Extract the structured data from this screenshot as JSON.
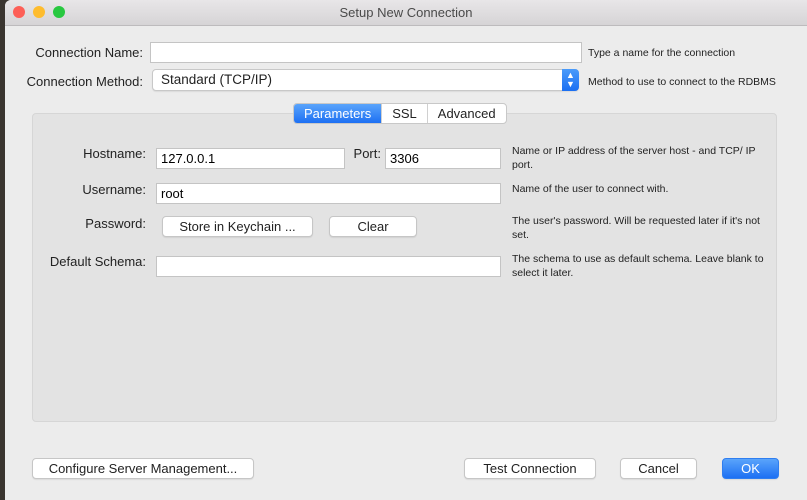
{
  "window": {
    "title": "Setup New Connection"
  },
  "connection_name": {
    "label": "Connection Name:",
    "value": "",
    "hint": "Type a name for the connection"
  },
  "connection_method": {
    "label": "Connection Method:",
    "value": "Standard (TCP/IP)",
    "hint": "Method to use to connect to the RDBMS"
  },
  "tabs": [
    {
      "label": "Parameters",
      "active": true
    },
    {
      "label": "SSL",
      "active": false
    },
    {
      "label": "Advanced",
      "active": false
    }
  ],
  "parameters": {
    "hostname": {
      "label": "Hostname:",
      "value": "127.0.0.1"
    },
    "port": {
      "label": "Port:",
      "value": "3306"
    },
    "host_hint": "Name or IP address of the server host - and TCP/ IP port.",
    "username": {
      "label": "Username:",
      "value": "root",
      "hint": "Name of the user to connect with."
    },
    "password": {
      "label": "Password:",
      "store_button": "Store in Keychain ...",
      "clear_button": "Clear",
      "hint": "The user's password. Will be requested later if it's not set."
    },
    "default_schema": {
      "label": "Default Schema:",
      "value": "",
      "hint": "The schema to use as default schema. Leave blank to select it later."
    }
  },
  "footer": {
    "configure": "Configure Server Management...",
    "test": "Test Connection",
    "cancel": "Cancel",
    "ok": "OK"
  },
  "colors": {
    "accent": "#1d70f3",
    "close": "#fd5f57",
    "minimize": "#febc2e",
    "zoom": "#28c840"
  }
}
